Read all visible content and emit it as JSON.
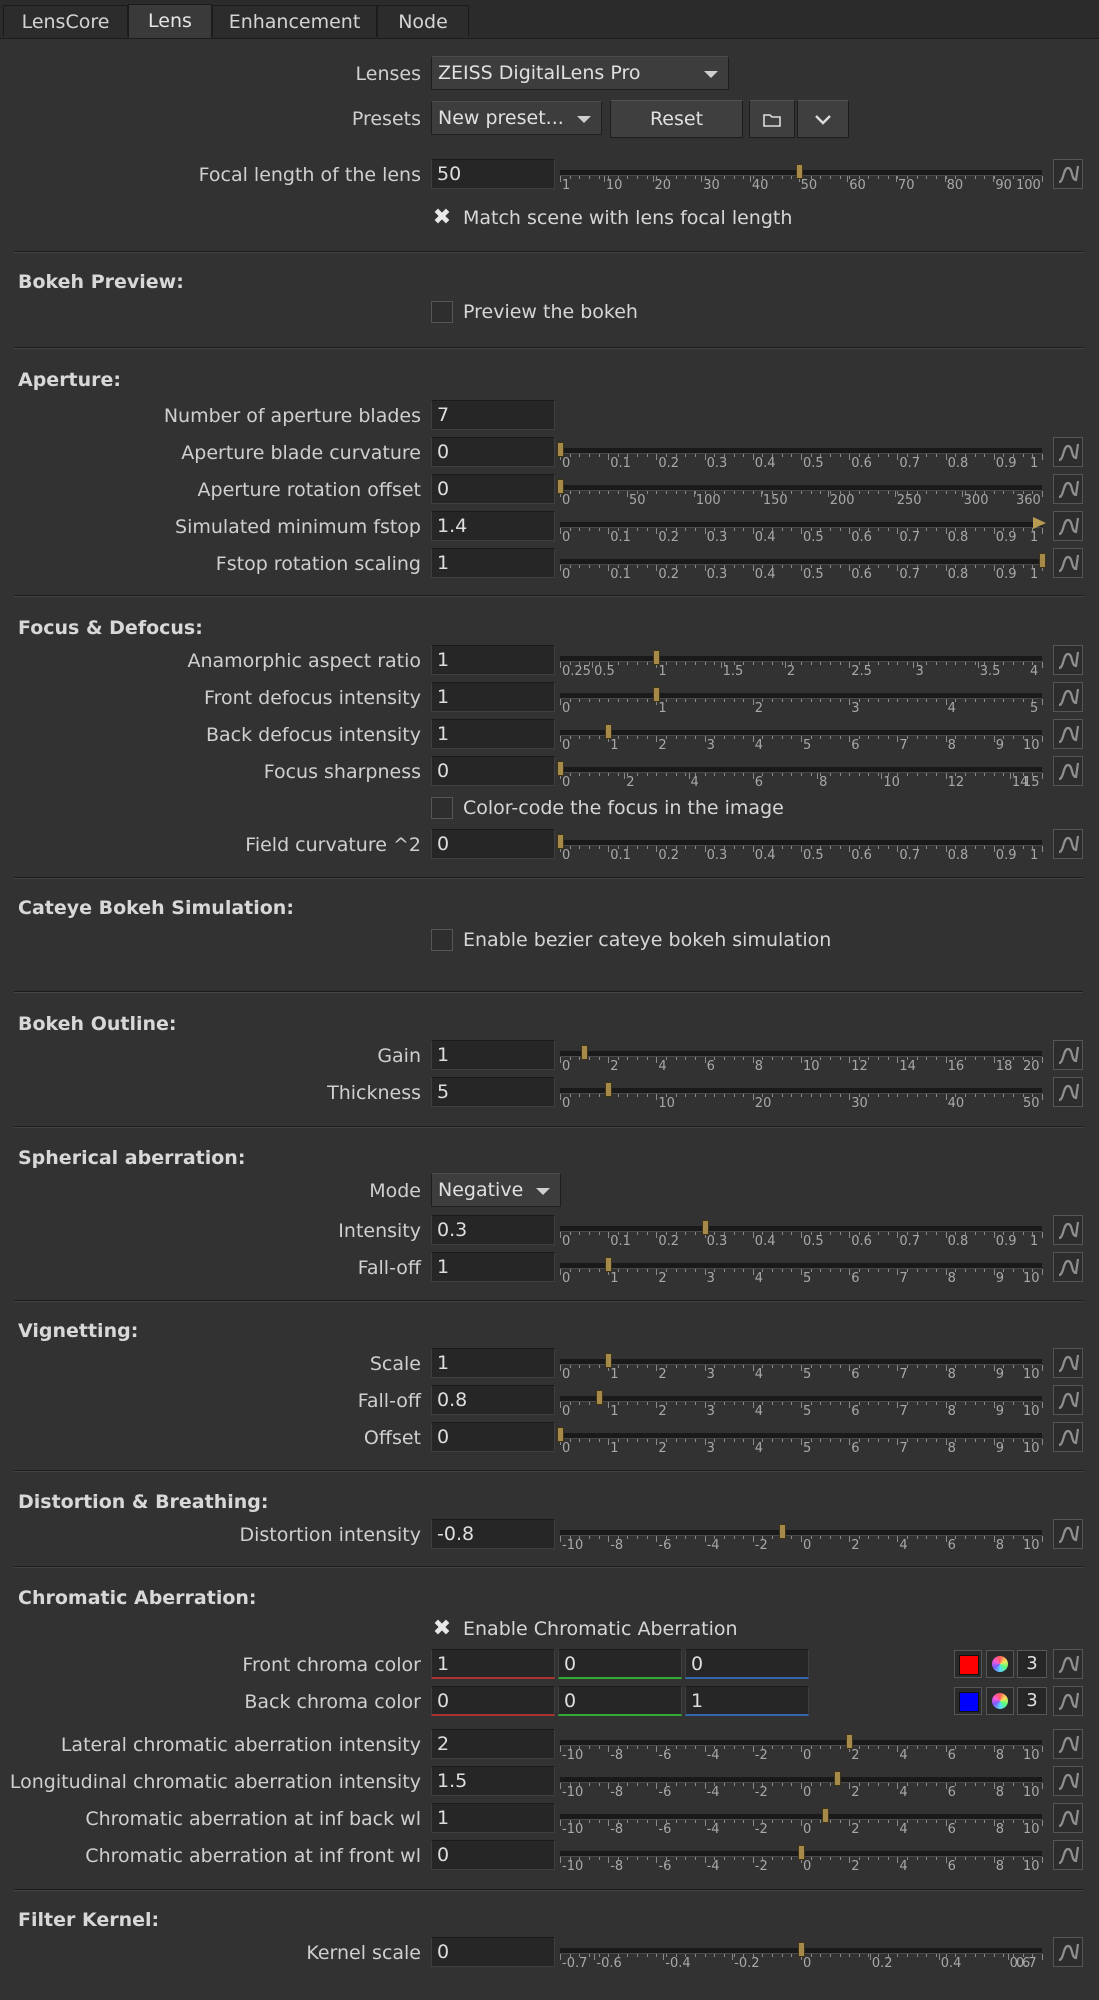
{
  "tabs": [
    "LensCore",
    "Lens",
    "Enhancement",
    "Node"
  ],
  "lens": {
    "lenses_label": "Lenses",
    "lenses_value": "ZEISS DigitalLens Pro",
    "presets_label": "Presets",
    "presets_value": "New preset...",
    "reset_label": "Reset",
    "folder_icon": "folder-icon",
    "chevron_icon": "chevron-down-icon",
    "focal_label": "Focal length of the lens",
    "focal_value": "50",
    "match_label": "Match scene with lens focal length",
    "match_checked": true
  },
  "bokeh_preview": {
    "title": "Bokeh Preview:",
    "preview_label": "Preview the bokeh",
    "preview_checked": false
  },
  "aperture": {
    "title": "Aperture:",
    "blades_label": "Number of aperture blades",
    "blades_value": "7",
    "curvature_label": "Aperture blade curvature",
    "curvature_value": "0",
    "rotation_label": "Aperture rotation offset",
    "rotation_value": "0",
    "fstop_label": "Simulated minimum fstop",
    "fstop_value": "1.4",
    "fstop_scaling_label": "Fstop rotation scaling",
    "fstop_scaling_value": "1"
  },
  "focus": {
    "title": "Focus & Defocus:",
    "anamorphic_label": "Anamorphic aspect ratio",
    "anamorphic_value": "1",
    "front_label": "Front defocus intensity",
    "front_value": "1",
    "back_label": "Back defocus intensity",
    "back_value": "1",
    "sharpness_label": "Focus sharpness",
    "sharpness_value": "0",
    "colorcode_label": "Color-code the focus in the image",
    "colorcode_checked": false,
    "field_label": "Field curvature ^2",
    "field_value": "0"
  },
  "cateye": {
    "title": "Cateye Bokeh Simulation:",
    "enable_label": "Enable bezier cateye bokeh simulation",
    "enable_checked": false
  },
  "outline": {
    "title": "Bokeh Outline:",
    "gain_label": "Gain",
    "gain_value": "1",
    "thickness_label": "Thickness",
    "thickness_value": "5"
  },
  "spherical": {
    "title": "Spherical aberration:",
    "mode_label": "Mode",
    "mode_value": "Negative",
    "intensity_label": "Intensity",
    "intensity_value": "0.3",
    "falloff_label": "Fall-off",
    "falloff_value": "1"
  },
  "vignetting": {
    "title": "Vignetting:",
    "scale_label": "Scale",
    "scale_value": "1",
    "falloff_label": "Fall-off",
    "falloff_value": "0.8",
    "offset_label": "Offset",
    "offset_value": "0"
  },
  "distortion": {
    "title": "Distortion & Breathing:",
    "intensity_label": "Distortion intensity",
    "intensity_value": "-0.8"
  },
  "chromatic": {
    "title": "Chromatic Aberration:",
    "enable_label": "Enable Chromatic Aberration",
    "enable_checked": true,
    "front_label": "Front chroma color",
    "front_r": "1",
    "front_g": "0",
    "front_b": "0",
    "front_swatch": "#ff0000",
    "front_channels": "3",
    "back_label": "Back chroma color",
    "back_r": "0",
    "back_g": "0",
    "back_b": "1",
    "back_swatch": "#0000ff",
    "back_channels": "3",
    "lateral_label": "Lateral chromatic aberration intensity",
    "lateral_value": "2",
    "longitudinal_label": "Longitudinal chromatic aberration intensity",
    "longitudinal_value": "1.5",
    "inf_back_label": "Chromatic aberration at inf back wl",
    "inf_back_value": "1",
    "inf_front_label": "Chromatic aberration at inf front wl",
    "inf_front_value": "0"
  },
  "filter": {
    "title": "Filter Kernel:",
    "kernel_label": "Kernel scale",
    "kernel_value": "0"
  },
  "colors": {
    "background": "#323232",
    "handle": "#a58a4a",
    "field": "#262626",
    "curve_icon": "#8f8f8f"
  },
  "sliders": {
    "focal": {
      "min": 1,
      "max": 100,
      "value": 50,
      "ticks": [
        "1",
        "10",
        "20",
        "30",
        "40",
        "50",
        "60",
        "70",
        "80",
        "90",
        "100"
      ]
    },
    "curvature": {
      "min": 0,
      "max": 1,
      "value": 0,
      "ticks": [
        "0",
        "0.1",
        "0.2",
        "0.3",
        "0.4",
        "0.5",
        "0.6",
        "0.7",
        "0.8",
        "0.9",
        "1"
      ]
    },
    "rotation": {
      "min": 0,
      "max": 360,
      "value": 0,
      "ticks": [
        "0",
        "50",
        "100",
        "150",
        "200",
        "250",
        "300",
        "360"
      ]
    },
    "fstop": {
      "min": 0,
      "max": 1,
      "value": 1.4,
      "ticks": [
        "0",
        "0.1",
        "0.2",
        "0.3",
        "0.4",
        "0.5",
        "0.6",
        "0.7",
        "0.8",
        "0.9",
        "1"
      ],
      "overflow": true
    },
    "fstop_scaling": {
      "min": 0,
      "max": 1,
      "value": 1,
      "ticks": [
        "0",
        "0.1",
        "0.2",
        "0.3",
        "0.4",
        "0.5",
        "0.6",
        "0.7",
        "0.8",
        "0.9",
        "1"
      ]
    },
    "anamorphic": {
      "min": 0.25,
      "max": 4,
      "value": 1,
      "ticks": [
        "0.25",
        "0.5",
        "1",
        "1.5",
        "2",
        "2.5",
        "3",
        "3.5",
        "4"
      ]
    },
    "front_defocus": {
      "min": 0,
      "max": 5,
      "value": 1,
      "ticks": [
        "0",
        "1",
        "2",
        "3",
        "4",
        "5"
      ]
    },
    "back_defocus": {
      "min": 0,
      "max": 10,
      "value": 1,
      "ticks": [
        "0",
        "1",
        "2",
        "3",
        "4",
        "5",
        "6",
        "7",
        "8",
        "9",
        "10"
      ]
    },
    "sharpness": {
      "min": 0,
      "max": 15,
      "value": 0,
      "ticks": [
        "0",
        "2",
        "4",
        "6",
        "8",
        "10",
        "12",
        "14",
        "15"
      ]
    },
    "field": {
      "min": 0,
      "max": 1,
      "value": 0,
      "ticks": [
        "0",
        "0.1",
        "0.2",
        "0.3",
        "0.4",
        "0.5",
        "0.6",
        "0.7",
        "0.8",
        "0.9",
        "1"
      ]
    },
    "gain": {
      "min": 0,
      "max": 20,
      "value": 1,
      "ticks": [
        "0",
        "2",
        "4",
        "6",
        "8",
        "10",
        "12",
        "14",
        "16",
        "18",
        "20"
      ]
    },
    "thickness": {
      "min": 0,
      "max": 50,
      "value": 5,
      "ticks": [
        "0",
        "10",
        "20",
        "30",
        "40",
        "50"
      ]
    },
    "sph_intensity": {
      "min": 0,
      "max": 1,
      "value": 0.3,
      "ticks": [
        "0",
        "0.1",
        "0.2",
        "0.3",
        "0.4",
        "0.5",
        "0.6",
        "0.7",
        "0.8",
        "0.9",
        "1"
      ]
    },
    "sph_falloff": {
      "min": 0,
      "max": 10,
      "value": 1,
      "ticks": [
        "0",
        "1",
        "2",
        "3",
        "4",
        "5",
        "6",
        "7",
        "8",
        "9",
        "10"
      ]
    },
    "vig_scale": {
      "min": 0,
      "max": 10,
      "value": 1,
      "ticks": [
        "0",
        "1",
        "2",
        "3",
        "4",
        "5",
        "6",
        "7",
        "8",
        "9",
        "10"
      ]
    },
    "vig_falloff": {
      "min": 0,
      "max": 10,
      "value": 0.8,
      "ticks": [
        "0",
        "1",
        "2",
        "3",
        "4",
        "5",
        "6",
        "7",
        "8",
        "9",
        "10"
      ]
    },
    "vig_offset": {
      "min": 0,
      "max": 10,
      "value": 0,
      "ticks": [
        "0",
        "1",
        "2",
        "3",
        "4",
        "5",
        "6",
        "7",
        "8",
        "9",
        "10"
      ]
    },
    "distortion": {
      "min": -10,
      "max": 10,
      "value": -0.8,
      "ticks": [
        "-10",
        "-8",
        "-6",
        "-4",
        "-2",
        "0",
        "2",
        "4",
        "6",
        "8",
        "10"
      ]
    },
    "lateral": {
      "min": -10,
      "max": 10,
      "value": 2,
      "ticks": [
        "-10",
        "-8",
        "-6",
        "-4",
        "-2",
        "0",
        "2",
        "4",
        "6",
        "8",
        "10"
      ]
    },
    "longitudinal": {
      "min": -10,
      "max": 10,
      "value": 1.5,
      "ticks": [
        "-10",
        "-8",
        "-6",
        "-4",
        "-2",
        "0",
        "2",
        "4",
        "6",
        "8",
        "10"
      ]
    },
    "inf_back": {
      "min": -10,
      "max": 10,
      "value": 1,
      "ticks": [
        "-10",
        "-8",
        "-6",
        "-4",
        "-2",
        "0",
        "2",
        "4",
        "6",
        "8",
        "10"
      ]
    },
    "inf_front": {
      "min": -10,
      "max": 10,
      "value": 0,
      "ticks": [
        "-10",
        "-8",
        "-6",
        "-4",
        "-2",
        "0",
        "2",
        "4",
        "6",
        "8",
        "10"
      ]
    },
    "kernel": {
      "min": -0.7,
      "max": 0.7,
      "value": 0,
      "ticks": [
        "-0.7",
        "-0.6",
        "-0.4",
        "-0.2",
        "0",
        "0.2",
        "0.4",
        "0.6",
        "0.7"
      ]
    }
  }
}
